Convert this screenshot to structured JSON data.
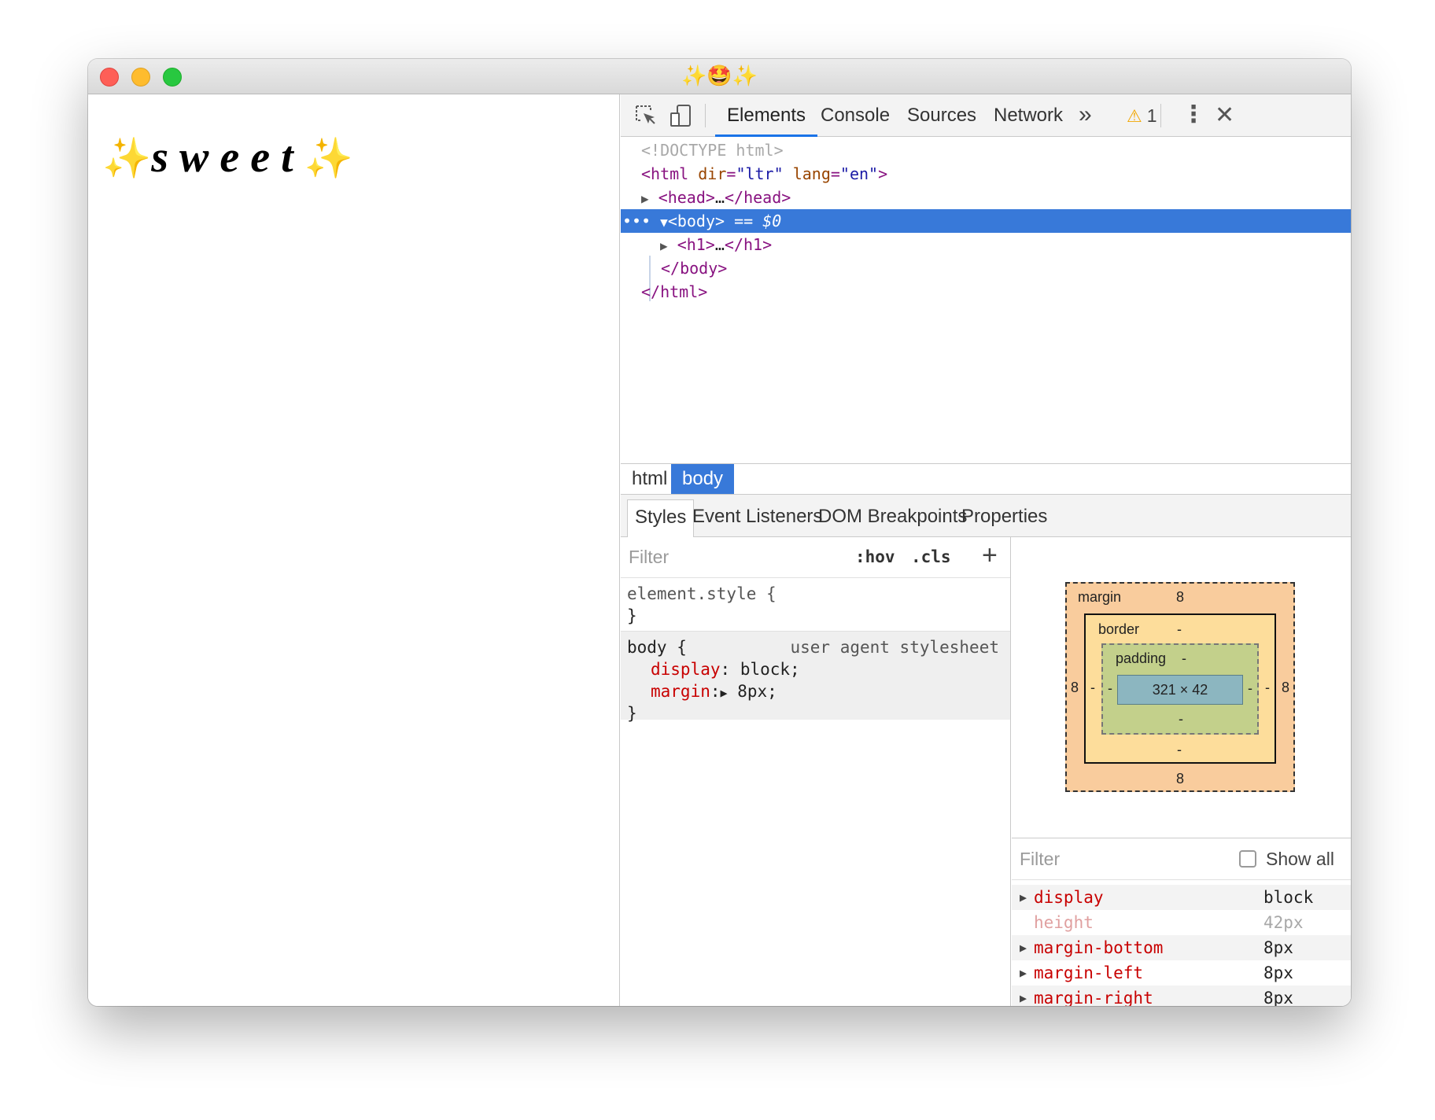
{
  "window": {
    "title": "✨🤩✨"
  },
  "page": {
    "heading_text": "sweet",
    "sparkle_left": "✨",
    "sparkle_right": "✨"
  },
  "devtools": {
    "tabs": [
      "Elements",
      "Console",
      "Sources",
      "Network"
    ],
    "overflow": "»",
    "warning_count": "1",
    "dom": {
      "doctype": "<!DOCTYPE html>",
      "html_open": "<html",
      "html_dir_attr": "dir",
      "html_dir_val": "\"ltr\"",
      "html_lang_attr": "lang",
      "html_lang_val": "\"en\"",
      "html_close_bracket": ">",
      "head_open": "<head>",
      "ellipsis": "…",
      "head_close": "</head>",
      "body_open": "<body>",
      "body_eq": "== $0",
      "h1_open": "<h1>",
      "h1_close": "</h1>",
      "body_close": "</body>",
      "html_close": "</html>",
      "dots": "•••"
    },
    "breadcrumbs": [
      "html",
      "body"
    ],
    "subtabs": [
      "Styles",
      "Event Listeners",
      "DOM Breakpoints",
      "Properties"
    ],
    "styles": {
      "filter_placeholder": "Filter",
      "hov": ":hov",
      "cls": ".cls",
      "plus": "+",
      "element_style": "element.style {",
      "close_brace": "}",
      "body_selector": "body {",
      "ua_label": "user agent stylesheet",
      "display_prop": "display",
      "display_val": "block;",
      "margin_prop": "margin",
      "margin_val": "8px;"
    },
    "box_model": {
      "margin_label": "margin",
      "margin_top": "8",
      "margin_bottom": "8",
      "margin_left": "8",
      "margin_right": "8",
      "border_label": "border",
      "border_top": "-",
      "border_bottom": "-",
      "border_left": "-",
      "border_right": "-",
      "padding_label": "padding",
      "padding_top": "-",
      "padding_bottom": "-",
      "padding_left": "-",
      "padding_right": "-",
      "content": "321 × 42"
    },
    "computed": {
      "filter_placeholder": "Filter",
      "show_all": "Show all",
      "rows": [
        {
          "name": "display",
          "value": "block"
        },
        {
          "name": "height",
          "value": "42px"
        },
        {
          "name": "margin-bottom",
          "value": "8px"
        },
        {
          "name": "margin-left",
          "value": "8px"
        },
        {
          "name": "margin-right",
          "value": "8px"
        }
      ]
    }
  },
  "colors": {
    "selection_blue": "#3879d9",
    "active_tab_underline": "#1a73e8",
    "sparkle": "#f4c21b"
  }
}
